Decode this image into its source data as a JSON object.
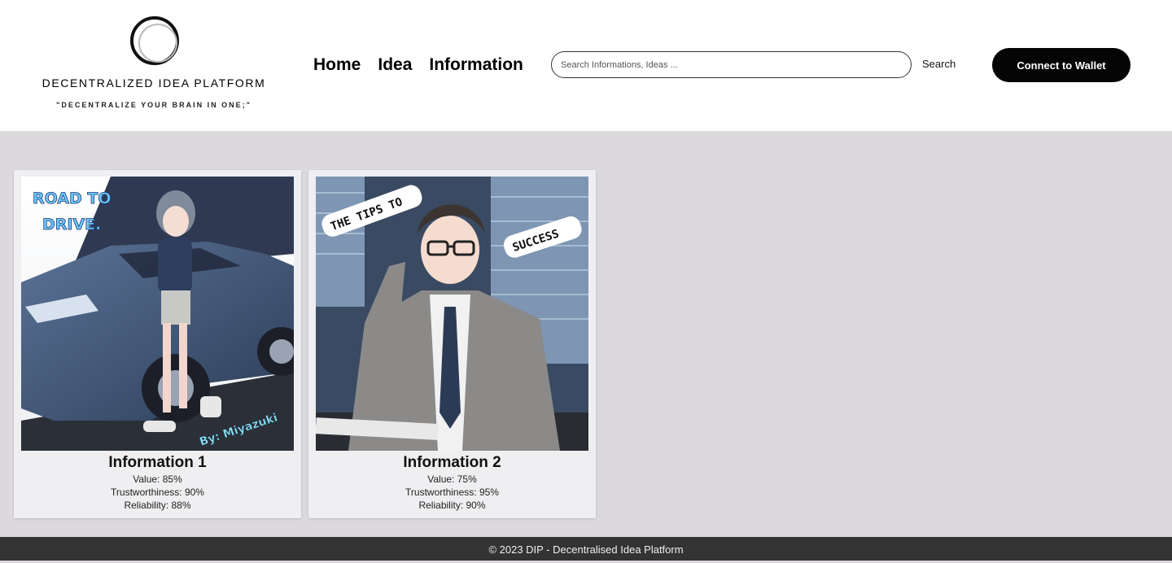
{
  "logo": {
    "title": "DECENTRALIZED IDEA PLATFORM",
    "tagline": "\"DECENTRALIZE YOUR BRAIN IN ONE;\""
  },
  "nav": {
    "items": [
      {
        "label": "Home"
      },
      {
        "label": "Idea"
      },
      {
        "label": "Information"
      }
    ]
  },
  "search": {
    "placeholder": "Search Informations, Ideas ...",
    "value": "",
    "button_label": "Search"
  },
  "wallet": {
    "button_label": "Connect to Wallet"
  },
  "cards": [
    {
      "title": "Information 1",
      "value": "Value: 85%",
      "trustworthiness": "Trustworthiness: 90%",
      "reliability": "Reliability: 88%",
      "image": {
        "icon": "anime-girl-car-illustration",
        "title_lines": [
          "ROAD TO",
          "DRIVE."
        ],
        "signature": "By: Miyazuki Shina"
      }
    },
    {
      "title": "Information 2",
      "value": "Value: 75%",
      "trustworthiness": "Trustworthiness: 95%",
      "reliability": "Reliability: 90%",
      "image": {
        "icon": "anime-businessman-illustration",
        "caption_left": "THE TIPS TO",
        "caption_right": "SUCCESS"
      }
    }
  ],
  "footer": {
    "text": "© 2023 DIP - Decentralised Idea Platform"
  },
  "colors": {
    "page_bg": "#dcd9dc",
    "header_bg": "#ffffff",
    "card_bg": "#efeef0",
    "wallet_button": "#050505",
    "footer_bg": "#333333",
    "title_accent": "#5ab8f0"
  }
}
